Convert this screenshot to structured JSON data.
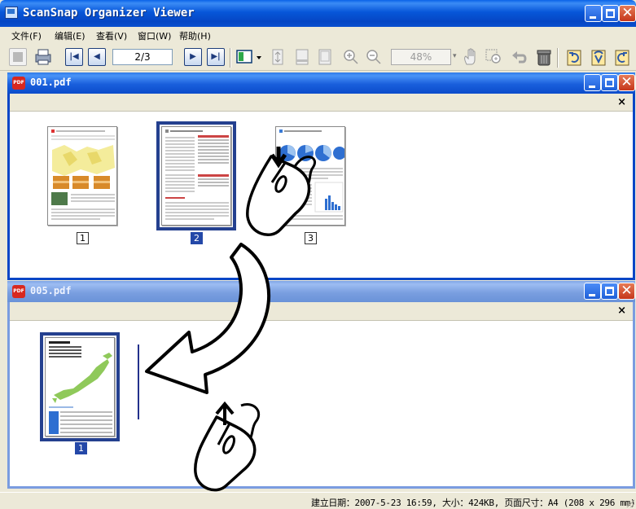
{
  "app": {
    "title": "ScanSnap Organizer Viewer",
    "menu": [
      "文件(F)",
      "编辑(E)",
      "查看(V)",
      "窗口(W)",
      "帮助(H)"
    ],
    "toolbar": {
      "page_indicator": "2/3",
      "zoom_value": "48%"
    },
    "status_text": "建立日期：2007-5-23 16:59, 大小：424KB, 页面尺寸：A4 (208 x 296 mm)"
  },
  "windows": [
    {
      "title": "001.pdf",
      "close_label": "×",
      "pages": [
        {
          "number": "1",
          "selected": false
        },
        {
          "number": "2",
          "selected": true
        },
        {
          "number": "3",
          "selected": false
        }
      ]
    },
    {
      "title": "005.pdf",
      "close_label": "×",
      "pages": [
        {
          "number": "1",
          "selected": true
        }
      ]
    }
  ],
  "colors": {
    "titlebar": "#0a4fcf",
    "selection": "#24408f",
    "pdf_icon": "#d8281f"
  },
  "icons": {
    "caption": [
      "minimize-icon",
      "maximize-icon",
      "close-icon"
    ],
    "toolbar": [
      "save-icon",
      "print-icon",
      "first-page-icon",
      "prev-page-icon",
      "next-page-icon",
      "last-page-icon",
      "thumbnail-view-icon",
      "fit-height-icon",
      "fit-width-icon",
      "fit-page-icon",
      "zoom-in-icon",
      "zoom-out-icon",
      "hand-tool-icon",
      "zoom-area-icon",
      "undo-icon",
      "trash-icon",
      "rotate-left-icon",
      "rotate-180-icon",
      "rotate-right-icon"
    ],
    "overlay": [
      "drag-arrow-icon",
      "mouse-press-icon",
      "mouse-release-icon"
    ]
  }
}
